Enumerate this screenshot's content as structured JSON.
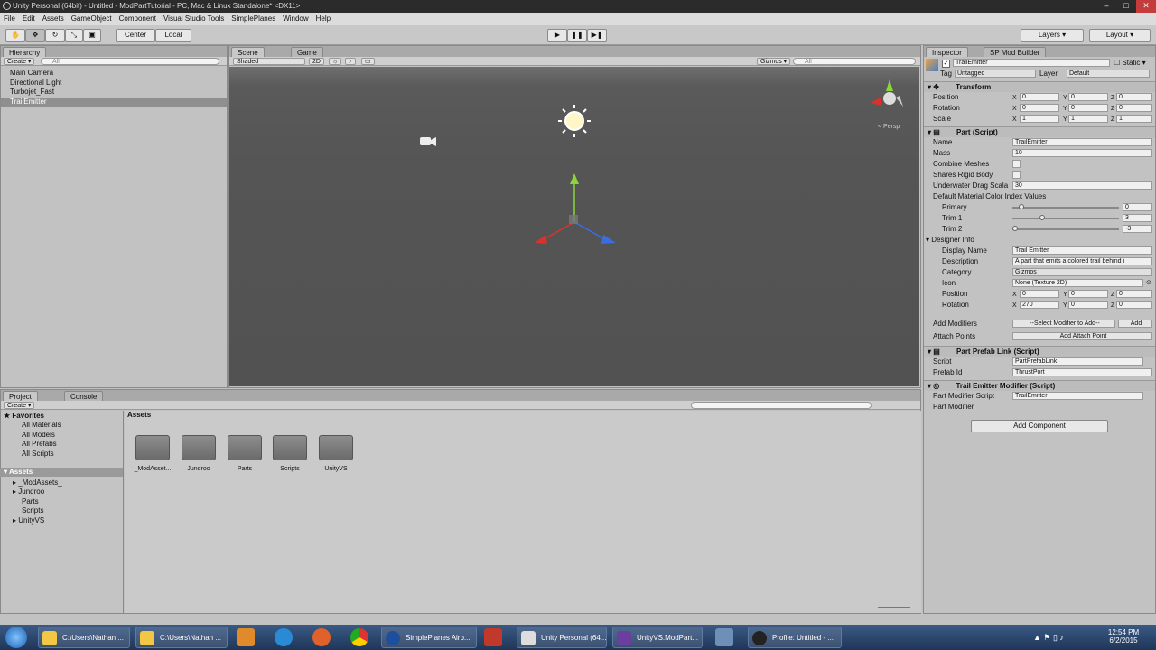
{
  "window": {
    "title": "Unity Personal (64bit) - Untitled - ModPartTutorial - PC, Mac & Linux Standalone* <DX11>"
  },
  "menu": [
    "File",
    "Edit",
    "Assets",
    "GameObject",
    "Component",
    "Visual Studio Tools",
    "SimplePlanes",
    "Window",
    "Help"
  ],
  "toolbar": {
    "center": "Center",
    "local": "Local",
    "layers": "Layers",
    "layout": "Layout"
  },
  "hierarchy": {
    "tab": "Hierarchy",
    "create": "Create",
    "search": "All",
    "items": [
      "Main Camera",
      "Directional Light",
      "Turbojet_Fast",
      "TrailEmitter"
    ]
  },
  "scene": {
    "tab_scene": "Scene",
    "tab_game": "Game",
    "shaded": "Shaded",
    "twod": "2D",
    "gizmos": "Gizmos",
    "search": "All",
    "persp": "< Persp"
  },
  "inspector": {
    "tab": "Inspector",
    "tab2": "SP Mod Builder",
    "object_name": "TrailEmitter",
    "static": "Static",
    "tag_label": "Tag",
    "tag": "Untagged",
    "layer_label": "Layer",
    "layer": "Default",
    "transform": {
      "title": "Transform",
      "position": "Position",
      "rotation": "Rotation",
      "scale": "Scale",
      "pos": [
        "0",
        "0",
        "0"
      ],
      "rot": [
        "0",
        "0",
        "0"
      ],
      "scl": [
        "1",
        "1",
        "1"
      ]
    },
    "part": {
      "title": "Part (Script)",
      "name_label": "Name",
      "name": "TrailEmitter",
      "mass_label": "Mass",
      "mass": "10",
      "combine": "Combine Meshes",
      "shares": "Shares Rigid Body",
      "drag_label": "Underwater Drag Scala",
      "drag": "30",
      "color_label": "Default Material Color Index Values",
      "primary": "Primary",
      "primary_v": "0",
      "trim1": "Trim 1",
      "trim1_v": "3",
      "trim2": "Trim 2",
      "trim2_v": "-3",
      "designer": "Designer Info",
      "display_label": "Display Name",
      "display": "Trail Emitter",
      "desc_label": "Description",
      "desc": "A part that emits a colored trail behind i",
      "cat_label": "Category",
      "cat": "Gizmos",
      "icon_label": "Icon",
      "icon": "None (Texture 2D)",
      "pos_label": "Position",
      "pos": [
        "0",
        "0",
        "0"
      ],
      "rot_label": "Rotation",
      "rot": [
        "270",
        "0",
        "0"
      ],
      "mods_label": "Add Modifiers",
      "mods": "--Select Modifier to Add--",
      "add": "Add",
      "attach_label": "Attach Points",
      "attach": "Add Attach Point"
    },
    "prefab": {
      "title": "Part Prefab Link (Script)",
      "script_label": "Script",
      "script": "PartPrefabLink",
      "id_label": "Prefab Id",
      "id": "ThrustPort"
    },
    "trail": {
      "title": "Trail Emitter Modifier (Script)",
      "script_label": "Part Modifier Script",
      "script": "TrailEmitter",
      "mod_label": "Part Modifier"
    },
    "add_component": "Add Component"
  },
  "project": {
    "tab": "Project",
    "tab2": "Console",
    "create": "Create",
    "favorites": "Favorites",
    "fav_items": [
      "All Materials",
      "All Models",
      "All Prefabs",
      "All Scripts"
    ],
    "assets": "Assets",
    "asset_tree": [
      "_ModAssets_",
      "Jundroo",
      "Parts",
      "Scripts",
      "UnityVS"
    ],
    "header": "Assets",
    "folders": [
      "_ModAsset...",
      "Jundroo",
      "Parts",
      "Scripts",
      "UnityVS"
    ]
  },
  "taskbar": {
    "tasks": [
      "C:\\Users\\Nathan ...",
      "C:\\Users\\Nathan ...",
      "SimplePlanes Airp...",
      "Unity Personal (64...",
      "UnityVS.ModPart...",
      "Profile: Untitled - ..."
    ],
    "time": "12:54 PM",
    "date": "6/2/2015"
  }
}
